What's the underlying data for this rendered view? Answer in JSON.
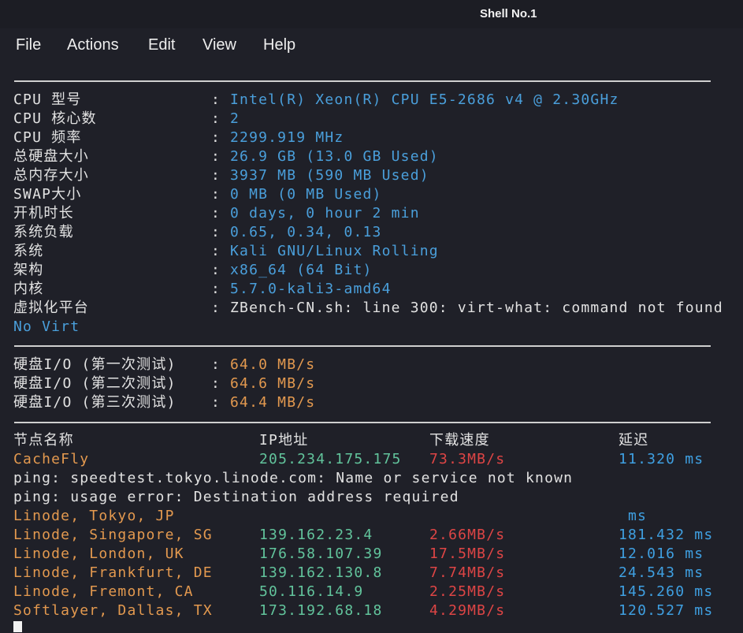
{
  "window": {
    "title": "Shell No.1"
  },
  "menu": [
    {
      "label": "File"
    },
    {
      "label": "Actions"
    },
    {
      "label": "Edit"
    },
    {
      "label": "View"
    },
    {
      "label": "Help"
    }
  ],
  "sys_info": {
    "sep": ":",
    "rows": [
      {
        "label": "CPU 型号",
        "value": "Intel(R) Xeon(R) CPU E5-2686 v4 @ 2.30GHz"
      },
      {
        "label": "CPU 核心数",
        "value": "2"
      },
      {
        "label": "CPU 频率",
        "value": "2299.919 MHz"
      },
      {
        "label": "总硬盘大小",
        "value": "26.9 GB (13.0 GB Used)"
      },
      {
        "label": "总内存大小",
        "value": "3937 MB (590 MB Used)"
      },
      {
        "label": "SWAP大小",
        "value": "0 MB (0 MB Used)"
      },
      {
        "label": "开机时长",
        "value": "0 days, 0 hour 2 min"
      },
      {
        "label": "系统负载",
        "value": "0.65, 0.34, 0.13"
      },
      {
        "label": "系统",
        "value": "Kali GNU/Linux Rolling"
      },
      {
        "label": "架构",
        "value": "x86_64 (64 Bit)"
      },
      {
        "label": "内核",
        "value": "5.7.0-kali3-amd64"
      },
      {
        "label": "虚拟化平台",
        "value": "ZBench-CN.sh: line 300: virt-what: command not found"
      }
    ],
    "virt_result": "No Virt"
  },
  "disk_io": {
    "sep": ":",
    "rows": [
      {
        "label": "硬盘I/O (第一次测试)",
        "value": "64.0 MB/s"
      },
      {
        "label": "硬盘I/O (第二次测试)",
        "value": "64.6 MB/s"
      },
      {
        "label": "硬盘I/O (第三次测试)",
        "value": "64.4 MB/s"
      }
    ]
  },
  "speed_table": {
    "headers": {
      "node": "节点名称",
      "ip": "IP地址",
      "speed": "下载速度",
      "latency": "延迟"
    },
    "rows": [
      {
        "node": "CacheFly",
        "ip": "205.234.175.175",
        "speed": "73.3MB/s",
        "latency": "11.320 ms"
      },
      {
        "node": "Linode, Tokyo, JP",
        "latency": "ms"
      },
      {
        "node": "Linode, Singapore, SG",
        "ip": "139.162.23.4",
        "speed": "2.66MB/s",
        "latency": "181.432 ms"
      },
      {
        "node": "Linode, London, UK",
        "ip": "176.58.107.39",
        "speed": "17.5MB/s",
        "latency": "12.016 ms"
      },
      {
        "node": "Linode, Frankfurt, DE",
        "ip": "139.162.130.8",
        "speed": "7.74MB/s",
        "latency": "24.543 ms"
      },
      {
        "node": "Linode, Fremont, CA",
        "ip": "50.116.14.9",
        "speed": "2.25MB/s",
        "latency": "145.260 ms"
      },
      {
        "node": "Softlayer, Dallas, TX",
        "ip": "173.192.68.18",
        "speed": "4.29MB/s",
        "latency": "120.527 ms"
      }
    ],
    "messages": [
      "ping: speedtest.tokyo.linode.com: Name or service not known",
      "ping: usage error: Destination address required"
    ]
  },
  "colors": {
    "background": "#1f2028",
    "text": "#e2e2e2",
    "value_blue": "#4a9fdb",
    "orange": "#e3994f",
    "green": "#62c49c",
    "red": "#de4545",
    "latency_blue": "#3fa0e2"
  }
}
